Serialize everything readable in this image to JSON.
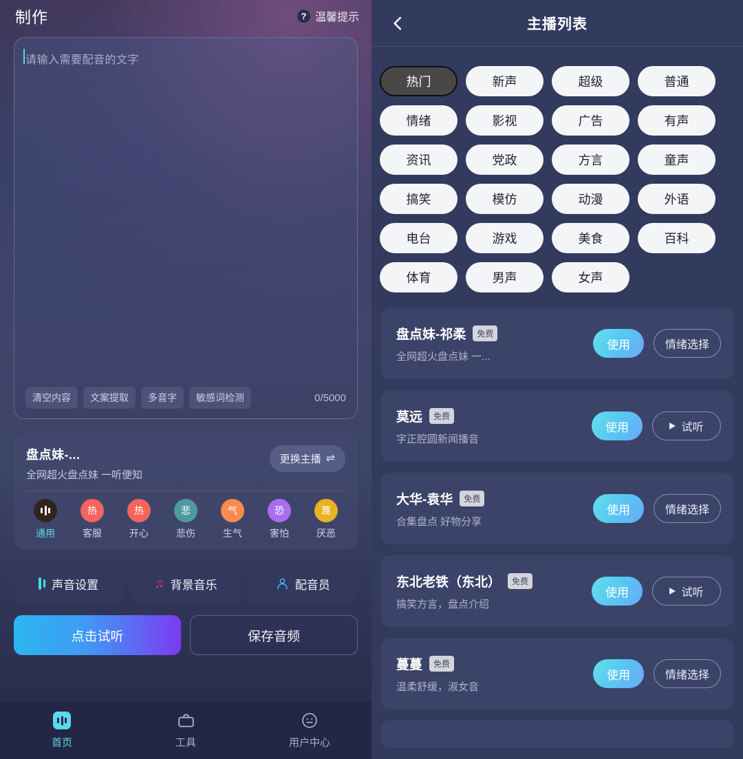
{
  "left": {
    "title": "制作",
    "tip_label": "温馨提示",
    "tip_icon": "question-circle-icon",
    "editor": {
      "placeholder": "请输入需要配音的文字",
      "value": "",
      "counter": "0/5000",
      "tools": [
        "清空内容",
        "文案提取",
        "多音字",
        "敏感词检测"
      ]
    },
    "speaker": {
      "name": "盘点妹-...",
      "desc": "全网超火盘点妹 一听便知",
      "swap_label": "更换主播",
      "swap_icon": "swap-arrows-icon",
      "emotions": [
        {
          "label": "通用",
          "glyph": "",
          "icon": "waveform-icon",
          "color": "#32241c",
          "active": true
        },
        {
          "label": "客服",
          "glyph": "热",
          "icon": "emotion-icon",
          "color": "#f4645d",
          "active": false
        },
        {
          "label": "开心",
          "glyph": "热",
          "icon": "emotion-icon",
          "color": "#f4645d",
          "active": false
        },
        {
          "label": "悲伤",
          "glyph": "悲",
          "icon": "emotion-icon",
          "color": "#4e9a9e",
          "active": false
        },
        {
          "label": "生气",
          "glyph": "气",
          "icon": "emotion-icon",
          "color": "#f98b4f",
          "active": false
        },
        {
          "label": "害怕",
          "glyph": "恐",
          "icon": "emotion-icon",
          "color": "#a96ef0",
          "active": false
        },
        {
          "label": "厌恶",
          "glyph": "蔑",
          "icon": "emotion-icon",
          "color": "#e7b323",
          "active": false
        }
      ]
    },
    "tools": [
      {
        "label": "声音设置",
        "icon": "equalizer-icon"
      },
      {
        "label": "背景音乐",
        "icon": "music-note-icon"
      },
      {
        "label": "配音员",
        "icon": "person-icon"
      }
    ],
    "cta": {
      "primary": "点击试听",
      "secondary": "保存音频"
    },
    "tabbar": [
      {
        "label": "首页",
        "icon": "home-waveform-icon",
        "active": true
      },
      {
        "label": "工具",
        "icon": "toolbox-icon",
        "active": false
      },
      {
        "label": "用户中心",
        "icon": "smiley-face-icon",
        "active": false
      }
    ]
  },
  "right": {
    "title": "主播列表",
    "back_icon": "chevron-left-icon",
    "categories": [
      {
        "label": "热门",
        "selected": true
      },
      {
        "label": "新声",
        "selected": false
      },
      {
        "label": "超级",
        "selected": false
      },
      {
        "label": "普通",
        "selected": false
      },
      {
        "label": "情绪",
        "selected": false
      },
      {
        "label": "影视",
        "selected": false
      },
      {
        "label": "广告",
        "selected": false
      },
      {
        "label": "有声",
        "selected": false
      },
      {
        "label": "资讯",
        "selected": false
      },
      {
        "label": "党政",
        "selected": false
      },
      {
        "label": "方言",
        "selected": false
      },
      {
        "label": "童声",
        "selected": false
      },
      {
        "label": "搞笑",
        "selected": false
      },
      {
        "label": "模仿",
        "selected": false
      },
      {
        "label": "动漫",
        "selected": false
      },
      {
        "label": "外语",
        "selected": false
      },
      {
        "label": "电台",
        "selected": false
      },
      {
        "label": "游戏",
        "selected": false
      },
      {
        "label": "美食",
        "selected": false
      },
      {
        "label": "百科",
        "selected": false
      },
      {
        "label": "体育",
        "selected": false
      },
      {
        "label": "男声",
        "selected": false
      },
      {
        "label": "女声",
        "selected": false
      }
    ],
    "use_label": "使用",
    "speakers": [
      {
        "name": "盘点妹-祁柔",
        "badge": "免费",
        "desc": "全网超火盘点妹 一...",
        "action_label": "情绪选择",
        "action_type": "emotion"
      },
      {
        "name": "莫远",
        "badge": "免费",
        "desc": "字正腔圆新闻播音",
        "action_label": "试听",
        "action_type": "preview"
      },
      {
        "name": "大华-袁华",
        "badge": "免费",
        "desc": "合集盘点 好物分享",
        "action_label": "情绪选择",
        "action_type": "emotion"
      },
      {
        "name": "东北老铁（东北）",
        "badge": "免费",
        "desc": "搞笑方言，盘点介绍",
        "action_label": "试听",
        "action_type": "preview"
      },
      {
        "name": "蔓蔓",
        "badge": "免费",
        "desc": "温柔舒缓，淑女音",
        "action_label": "情绪选择",
        "action_type": "emotion"
      }
    ]
  }
}
